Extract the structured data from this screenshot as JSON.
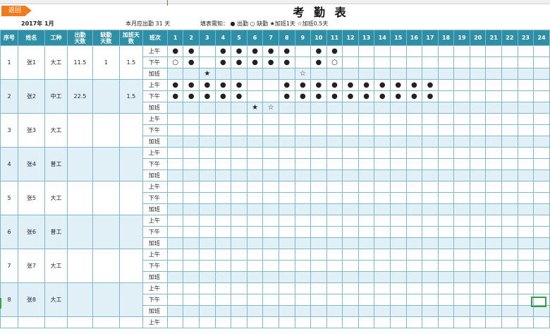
{
  "back_label": "返回",
  "title": "考 勤 表",
  "year_month": "2017年 1月",
  "required_days": "本月应出勤 31 天",
  "legend": "填表需知：  ● 出勤   ○ 缺勤   ★加班1天   ☆加班0.5天",
  "headers": {
    "no": "序号",
    "name": "姓名",
    "worktype": "工种",
    "attend": [
      "出勤",
      "天数"
    ],
    "absent": [
      "缺勤",
      "天数"
    ],
    "overtime": [
      "加班天",
      "数"
    ],
    "session": "班次"
  },
  "days": [
    "1",
    "2",
    "3",
    "4",
    "5",
    "6",
    "7",
    "8",
    "9",
    "10",
    "11",
    "12",
    "13",
    "14",
    "15",
    "16",
    "17",
    "18",
    "19",
    "20",
    "21",
    "22",
    "23",
    "24"
  ],
  "sessions": [
    "上午",
    "下午",
    "加班"
  ],
  "employees": [
    {
      "no": "1",
      "name": "张1",
      "worktype": "大工",
      "attend": "11.5",
      "absent": "1",
      "overtime": "1.5",
      "marks": [
        {
          "1": "●",
          "2": "●",
          "4": "●",
          "5": "●",
          "6": "●",
          "7": "●",
          "8": "●",
          "10": "●",
          "11": "●"
        },
        {
          "1": "○",
          "2": "●",
          "4": "●",
          "5": "●",
          "6": "●",
          "7": "●",
          "8": "●",
          "10": "●",
          "11": "○"
        },
        {
          "3": "★",
          "9": "☆"
        }
      ]
    },
    {
      "no": "2",
      "name": "张2",
      "worktype": "中工",
      "attend": "22.5",
      "absent": "",
      "overtime": "1.5",
      "marks": [
        {
          "1": "●",
          "2": "●",
          "3": "●",
          "4": "●",
          "5": "●",
          "8": "●",
          "9": "●",
          "10": "●",
          "11": "●",
          "12": "●",
          "13": "●",
          "14": "●",
          "15": "●",
          "16": "●",
          "17": "●"
        },
        {
          "1": "●",
          "2": "●",
          "3": "●",
          "4": "●",
          "5": "●",
          "8": "●",
          "9": "●",
          "10": "●",
          "11": "●",
          "12": "●",
          "13": "●",
          "14": "●",
          "15": "●",
          "16": "●",
          "17": "●"
        },
        {
          "6": "★",
          "7": "☆"
        }
      ]
    },
    {
      "no": "3",
      "name": "张3",
      "worktype": "大工",
      "attend": "",
      "absent": "",
      "overtime": "",
      "marks": [
        {},
        {},
        {}
      ]
    },
    {
      "no": "4",
      "name": "张4",
      "worktype": "普工",
      "attend": "",
      "absent": "",
      "overtime": "",
      "marks": [
        {},
        {},
        {}
      ]
    },
    {
      "no": "5",
      "name": "张5",
      "worktype": "大工",
      "attend": "",
      "absent": "",
      "overtime": "",
      "marks": [
        {},
        {},
        {}
      ]
    },
    {
      "no": "6",
      "name": "张6",
      "worktype": "普工",
      "attend": "",
      "absent": "",
      "overtime": "",
      "marks": [
        {},
        {},
        {}
      ]
    },
    {
      "no": "7",
      "name": "张7",
      "worktype": "大工",
      "attend": "",
      "absent": "",
      "overtime": "",
      "marks": [
        {},
        {},
        {}
      ]
    },
    {
      "no": "8",
      "name": "张8",
      "worktype": "大工",
      "attend": "",
      "absent": "",
      "overtime": "",
      "marks": [
        {},
        {},
        {}
      ]
    }
  ],
  "partial_row_session": "上午"
}
